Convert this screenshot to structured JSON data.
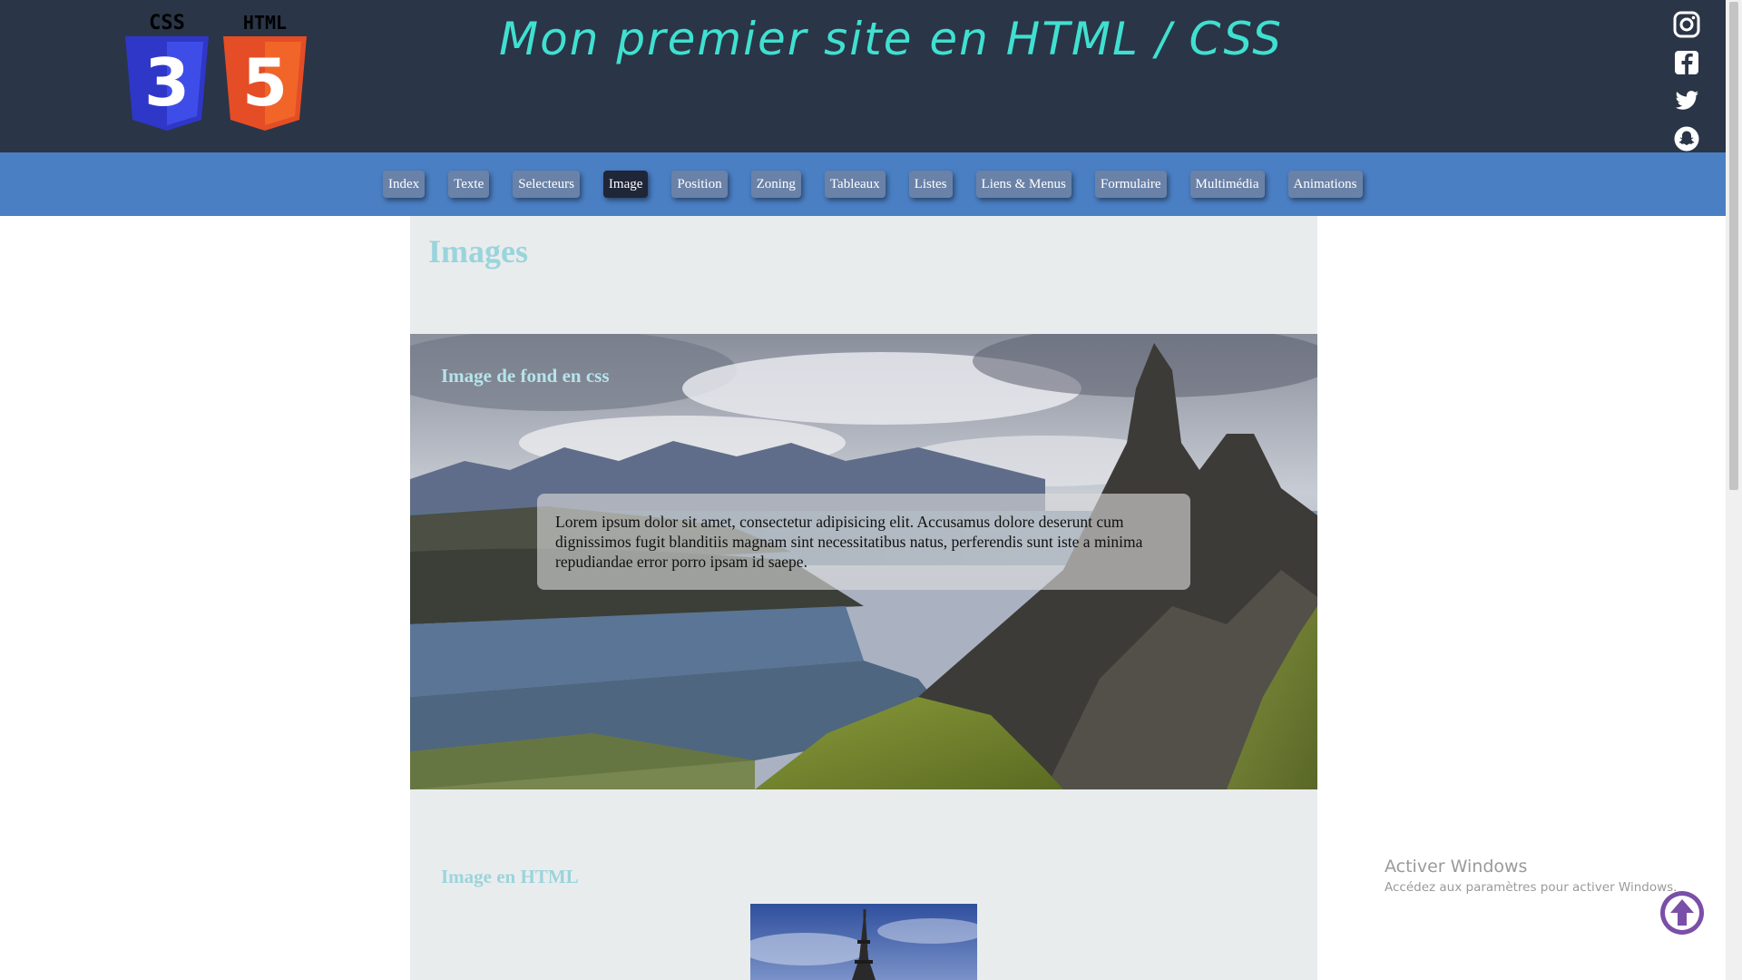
{
  "header": {
    "title": "Mon premier site en HTML / CSS",
    "logos": [
      {
        "label": "CSS",
        "digit": "3",
        "color": "#3b3fd9"
      },
      {
        "label": "HTML",
        "digit": "5",
        "color": "#e44d26"
      }
    ],
    "social_icons": [
      "instagram-icon",
      "facebook-icon",
      "twitter-icon",
      "snapchat-icon"
    ]
  },
  "nav": {
    "items": [
      {
        "label": "Index"
      },
      {
        "label": "Texte"
      },
      {
        "label": "Selecteurs"
      },
      {
        "label": "Image",
        "active": true
      },
      {
        "label": "Position"
      },
      {
        "label": "Zoning"
      },
      {
        "label": "Tableaux"
      },
      {
        "label": "Listes"
      },
      {
        "label": "Liens & Menus"
      },
      {
        "label": "Formulaire"
      },
      {
        "label": "Multimédia"
      },
      {
        "label": "Animations"
      }
    ]
  },
  "main": {
    "title": "Images",
    "bg_section": {
      "heading": "Image de fond en css",
      "text": "Lorem ipsum dolor sit amet, consectetur adipisicing elit. Accusamus dolore deserunt cum dignissimos fugit blanditiis magnam sint necessitatibus natus, perferendis sunt iste a minima repudiandae error porro ipsam id saepe."
    },
    "html_section": {
      "heading": "Image en HTML"
    }
  },
  "windows_watermark": {
    "title": "Activer Windows",
    "subtitle": "Accédez aux paramètres pour activer Windows."
  },
  "colors": {
    "header_bg": "#2a3547",
    "nav_bg": "#4a7fc4",
    "title_color": "#40e0d0",
    "up_button": "#7a4fa8"
  }
}
